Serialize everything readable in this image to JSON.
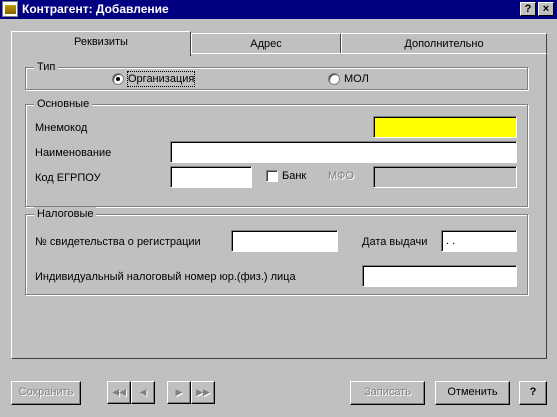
{
  "window": {
    "title": "Контрагент: Добавление",
    "help_button": "?",
    "close_button": "×"
  },
  "tabs": [
    {
      "label": "Реквизиты",
      "active": true
    },
    {
      "label": "Адрес",
      "active": false
    },
    {
      "label": "Дополнительно",
      "active": false
    }
  ],
  "type_group": {
    "legend": "Тип",
    "options": [
      {
        "label": "Организация",
        "selected": true
      },
      {
        "label": "МОЛ",
        "selected": false
      }
    ]
  },
  "main_group": {
    "legend": "Основные",
    "mnemocode_label": "Мнемокод",
    "mnemocode_value": "",
    "name_label": "Наименование",
    "name_value": "",
    "edrpou_label": "Код ЕГРПОУ",
    "edrpou_value": "",
    "bank_label": "Банк",
    "bank_checked": false,
    "mfo_label": "МФО",
    "mfo_value": ""
  },
  "tax_group": {
    "legend": "Налоговые",
    "certificate_label": "№ свидетельства о регистрации",
    "certificate_value": "",
    "issue_date_label": "Дата выдачи",
    "issue_date_value": " .  .",
    "tax_number_label": "Индивидуальный налоговый номер юр.(физ.) лица",
    "tax_number_value": ""
  },
  "footer": {
    "save_label": "Сохранить",
    "nav_first": "◀◀",
    "nav_prev": "◀",
    "nav_next": "▶",
    "nav_last": "▶▶",
    "write_label": "Записать",
    "cancel_label": "Отменить",
    "help_label": "?"
  },
  "colors": {
    "titlebar": "#000080",
    "window_bg": "#c0c0c0",
    "required_field": "#ffff00"
  }
}
